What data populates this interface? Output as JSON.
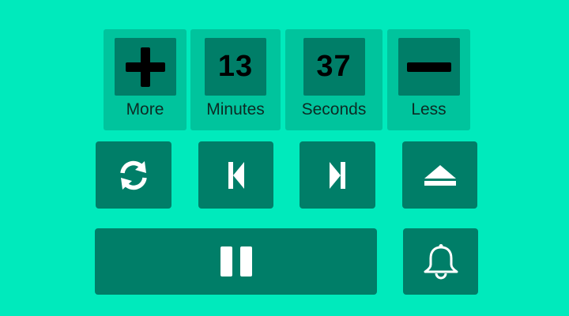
{
  "colors": {
    "background": "#00eabc",
    "tile": "#00c49d",
    "button": "#007e68",
    "icon_light": "#ffffff",
    "icon_dark": "#000000"
  },
  "timer": {
    "more_label": "More",
    "minutes_value": "13",
    "minutes_label": "Minutes",
    "seconds_value": "37",
    "seconds_label": "Seconds",
    "less_label": "Less"
  },
  "icons": {
    "more": "plus-icon",
    "less": "minus-icon",
    "repeat": "refresh-icon",
    "previous": "skip-previous-icon",
    "next": "skip-next-icon",
    "eject": "eject-icon",
    "pause": "pause-icon",
    "alarm": "bell-icon"
  }
}
